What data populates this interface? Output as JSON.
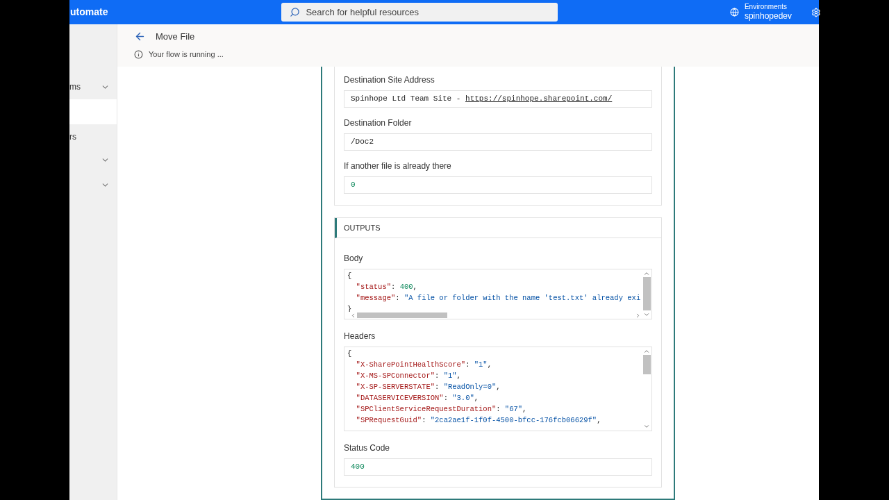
{
  "topbar": {
    "app_title": "utomate",
    "search": {
      "placeholder": "Search for helpful resources"
    },
    "environment": {
      "label": "Environments",
      "name": "spinhopedev"
    }
  },
  "sidebar": {
    "items": [
      {
        "label": "ms",
        "chevron": true,
        "selected": false
      },
      {
        "chevron": false,
        "selected": true
      },
      {
        "label": "rs",
        "chevron": false,
        "selected": false
      },
      {
        "chevron": true,
        "selected": false
      },
      {
        "chevron": true,
        "selected": false
      }
    ]
  },
  "header": {
    "title": "Move File",
    "status": "Your flow is running ..."
  },
  "inputs": [
    {
      "label": "Destination Site Address",
      "kind": "text",
      "value": "Spinhope Ltd Team Site - ",
      "link": "https://spinhope.sharepoint.com/"
    },
    {
      "label": "Destination Folder",
      "kind": "text",
      "value": "/Doc2"
    },
    {
      "label": "If another file is already there",
      "kind": "number",
      "value": "0"
    }
  ],
  "outputs": {
    "title": "OUTPUTS",
    "body": {
      "label": "Body",
      "lines": [
        [
          {
            "kind": "punct",
            "text": "{"
          }
        ],
        [
          {
            "kind": "key",
            "text": "  \"status\""
          },
          {
            "kind": "punct",
            "text": ": "
          },
          {
            "kind": "number",
            "text": "400"
          },
          {
            "kind": "punct",
            "text": ","
          }
        ],
        [
          {
            "kind": "key",
            "text": "  \"message\""
          },
          {
            "kind": "punct",
            "text": ": "
          },
          {
            "kind": "string",
            "text": "\"A file or folder with the name 'test.txt' already exi"
          }
        ],
        [
          {
            "kind": "punct",
            "text": "}"
          }
        ]
      ]
    },
    "headers": {
      "label": "Headers",
      "lines": [
        [
          {
            "kind": "punct",
            "text": "{"
          }
        ],
        [
          {
            "kind": "key",
            "text": "  \"X-SharePointHealthScore\""
          },
          {
            "kind": "punct",
            "text": ": "
          },
          {
            "kind": "string",
            "text": "\"1\""
          },
          {
            "kind": "punct",
            "text": ","
          }
        ],
        [
          {
            "kind": "key",
            "text": "  \"X-MS-SPConnector\""
          },
          {
            "kind": "punct",
            "text": ": "
          },
          {
            "kind": "string",
            "text": "\"1\""
          },
          {
            "kind": "punct",
            "text": ","
          }
        ],
        [
          {
            "kind": "key",
            "text": "  \"X-SP-SERVERSTATE\""
          },
          {
            "kind": "punct",
            "text": ": "
          },
          {
            "kind": "string",
            "text": "\"ReadOnly=0\""
          },
          {
            "kind": "punct",
            "text": ","
          }
        ],
        [
          {
            "kind": "key",
            "text": "  \"DATASERVICEVERSION\""
          },
          {
            "kind": "punct",
            "text": ": "
          },
          {
            "kind": "string",
            "text": "\"3.0\""
          },
          {
            "kind": "punct",
            "text": ","
          }
        ],
        [
          {
            "kind": "key",
            "text": "  \"SPClientServiceRequestDuration\""
          },
          {
            "kind": "punct",
            "text": ": "
          },
          {
            "kind": "string",
            "text": "\"67\""
          },
          {
            "kind": "punct",
            "text": ","
          }
        ],
        [
          {
            "kind": "key",
            "text": "  \"SPRequestGuid\""
          },
          {
            "kind": "punct",
            "text": ": "
          },
          {
            "kind": "string",
            "text": "\"2ca2ae1f-1f0f-4500-bfcc-176fcb06629f\""
          },
          {
            "kind": "punct",
            "text": ","
          }
        ]
      ]
    },
    "status_code": {
      "label": "Status Code",
      "kind": "number",
      "value": "400"
    }
  }
}
